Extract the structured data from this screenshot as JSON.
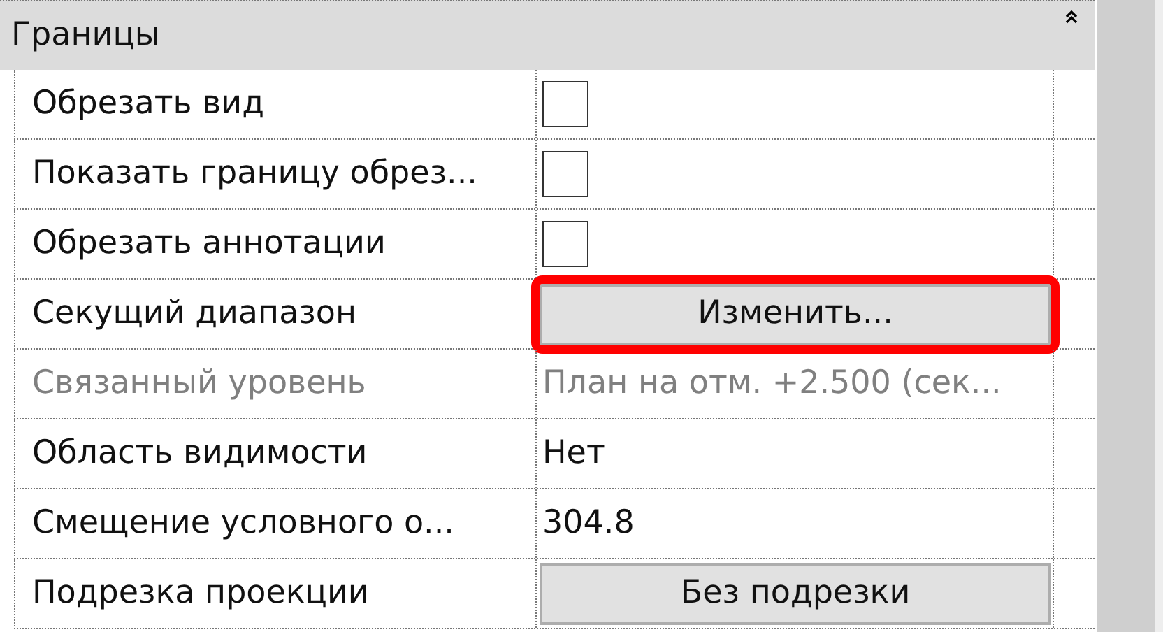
{
  "group": {
    "title": "Границы",
    "expanded": true
  },
  "rows": [
    {
      "kind": "checkbox",
      "label": "Обрезать вид",
      "checked": false
    },
    {
      "kind": "checkbox",
      "label": "Показать границу обрез...",
      "checked": false
    },
    {
      "kind": "checkbox",
      "label": "Обрезать аннотации",
      "checked": false
    },
    {
      "kind": "button",
      "label": "Секущий диапазон",
      "value": "Изменить...",
      "highlighted": true
    },
    {
      "kind": "text",
      "label": "Связанный уровень",
      "value": "План на отм. +2.500 (сек...",
      "disabled": true
    },
    {
      "kind": "text",
      "label": "Область видимости",
      "value": "Нет",
      "disabled": false
    },
    {
      "kind": "text",
      "label": "Смещение условного о...",
      "value": "304.8",
      "disabled": false
    },
    {
      "kind": "button",
      "label": "Подрезка проекции",
      "value": "Без подрезки",
      "highlighted": false
    }
  ]
}
